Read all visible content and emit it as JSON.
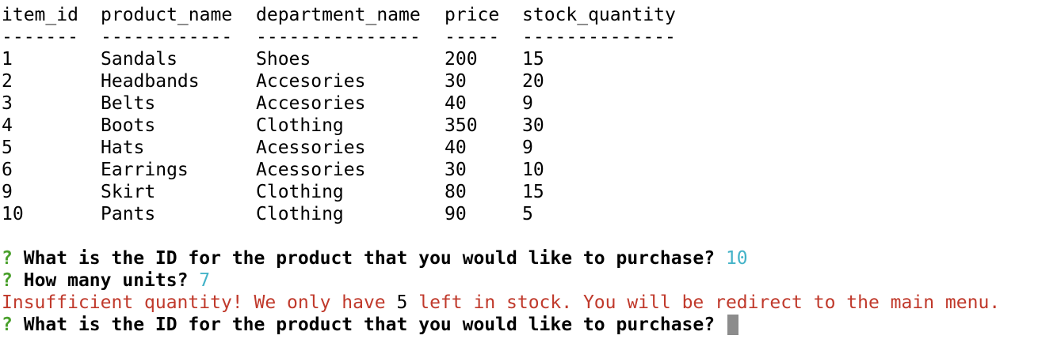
{
  "table": {
    "headers": [
      "item_id",
      "product_name",
      "department_name",
      "price",
      "stock_quantity"
    ],
    "separators": [
      "-------",
      "------------",
      "---------------",
      "-----",
      "--------------"
    ],
    "rows": [
      [
        "1",
        "Sandals",
        "Shoes",
        "200",
        "15"
      ],
      [
        "2",
        "Headbands",
        "Accesories",
        "30",
        "20"
      ],
      [
        "3",
        "Belts",
        "Accesories",
        "40",
        "9"
      ],
      [
        "4",
        "Boots",
        "Clothing",
        "350",
        "30"
      ],
      [
        "5",
        "Hats",
        "Acessories",
        "40",
        "9"
      ],
      [
        "6",
        "Earrings",
        "Acessories",
        "30",
        "10"
      ],
      [
        "9",
        "Skirt",
        "Clothing",
        "80",
        "15"
      ],
      [
        "10",
        "Pants",
        "Clothing",
        "90",
        "5"
      ]
    ]
  },
  "prompts": {
    "qmark": "?",
    "q1": "What is the ID for the product that you would like to purchase?",
    "a1": "10",
    "q2": "How many units?",
    "a2": "7",
    "error_pre": "Insufficient quantity! We only have",
    "error_num": "5",
    "error_post": "left in stock. You will be redirect to the main menu.",
    "q3": "What is the ID for the product that you would like to purchase?"
  },
  "colors": {
    "qmark": "#4aa02c",
    "answer": "#44b3c8",
    "error": "#c0392b",
    "cursor": "#8c8c8c",
    "partial_magenta": "#c23cc2",
    "partial_yellow": "#c7c400"
  }
}
